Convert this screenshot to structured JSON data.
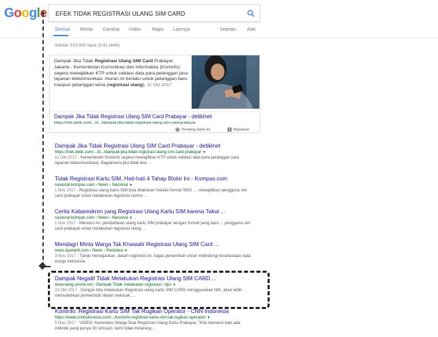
{
  "logo": {
    "text": "Google"
  },
  "search": {
    "query": "EFEK TIDAK REGISTRASI ULANG SIM CARD"
  },
  "tabs": {
    "items": [
      "Semua",
      "Berita",
      "Gambar",
      "Video",
      "Maps",
      "Lainnya"
    ],
    "settings": "Setelan",
    "tools": "Alat"
  },
  "stats": "Sekitar 319.000 hasil (0,41 detik)",
  "snippet": {
    "text_parts": [
      "Dampak Jika Tidak ",
      "Registrasi Ulang SIM Card",
      " Prabayar. Jakarta - Kementerian Komunikasi dan Informatika (Kominfo) segera mewajibkan KTP untuk validasi data para pelanggan jasa layanan telekomunikasi. Aturan ini berlaku untuk pelanggan baru maupun pelanggan lama (",
      "registrasi ulang",
      "). ",
      "11 Okt 2017"
    ],
    "title": "Dampak Jika Tidak Registrasi Ulang SIM Card Prabayar - detikInet",
    "url": "https://inet.detik.com/.../d.../dampak-jika-tidak-registrasi-ulang-sim-card-prabayar",
    "feedback_about": "Tentang kartu ini",
    "feedback": "Masukan"
  },
  "results": [
    {
      "title": "Dampak Jika Tidak Registrasi Ulang SIM Card Prabayar - detikInet",
      "url": "https://inet.detik.com/.../d.../dampak-jika-tidak-registrasi-ulang-sim-card-prabayar",
      "date": "11 Okt 2017",
      "desc": " - Kementerian Kominfo segera mewajibkan KTP untuk validasi data para pelanggan jasa layanan telekomunikasi). Bagaimana jika tidak ikut ..."
    },
    {
      "title": "Tidak Registrasi Kartu SIM, Hati-hati 4 Tahap Blokir Ini - Kompas.com",
      "url": "nasional.kompas.com › News › Nasional",
      "date": "1 Nov 2017",
      "desc": " - Registrasi ulang kartu SIM bisa dilakukan melalui format SMS. ... mewajibkan pengguna sim card prabayar untuk melakukan registrasi nomor ..."
    },
    {
      "title": "Cerita Kabareskrim yang Registrasi Ulang Kartu SIM karena Takut ...",
      "url": "nasional.kompas.com › News › Nasional",
      "date": "1 Nov 2017",
      "desc": " - Menurut Ari, pendaftaran ulang kartu SIM prabayar dengan format yang baru ... pengguna sim card prabayar untuk melakukan registrasi ulang ..."
    },
    {
      "title": "Mendagri Minta Warga Tak Khawatir Registrasi Ulang SIM Card ...",
      "url": "news.liputan6.com › News › Peristiwa",
      "date": "3 Nov 2017",
      "desc": " - Tjahjo menegaskan, dalam registrasi ini, tugas pemerintah untuk melindungi kerahasiaan data warga Indonesia."
    },
    {
      "title": "Dampak Negatif Tidak Melakukan Registrasi Ulang SIM CARD ...",
      "url": "www.kang-ansrik.net › Dampak Tidak melakukan registrasi › tips",
      "date": "23 Okt 2017",
      "desc": " - Dengan kita melakukan Registrasi ulang kartu SIM CARD menggunakan NIK, akan lebih memudahkan pemerintah dalam melacak ..."
    },
    {
      "title": "Kominfo: Registrasi Kartu SIM Tak Rugikan Operator - CNN Indonesia",
      "url": "https://www.cnnindonesia.com/.../kominfo-registrasi-kartu-sim-tak-rugikan-operator/",
      "date": "5 Nov 2017",
      "desc": " - VIDEO: Kemenkes Warga Soal Registrasi Ulang Kartu Prabayar. \"Kita toleransi kalo ada individu yang punya 10 simcard, kami tidak melarang ..."
    }
  ],
  "colors": {
    "link": "#1a0dab",
    "url": "#006621",
    "accent": "#4285f4"
  }
}
